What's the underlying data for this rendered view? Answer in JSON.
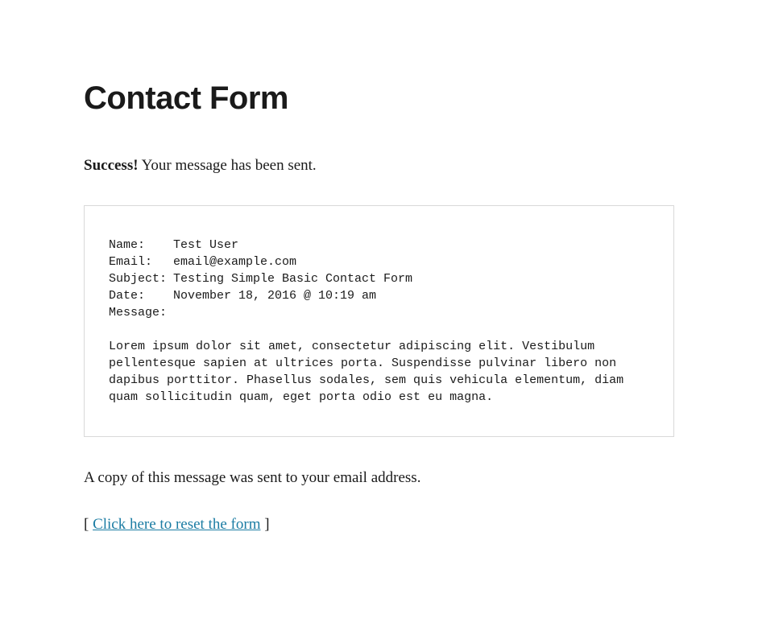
{
  "page": {
    "title": "Contact Form"
  },
  "success": {
    "bold": "Success!",
    "text": " Your message has been sent."
  },
  "fields": {
    "name_label": "Name:",
    "name_value": "Test User",
    "email_label": "Email:",
    "email_value": "email@example.com",
    "subject_label": "Subject:",
    "subject_value": "Testing Simple Basic Contact Form",
    "date_label": "Date:",
    "date_value": "November 18, 2016 @ 10:19 am",
    "message_label": "Message:",
    "message_body": "Lorem ipsum dolor sit amet, consectetur adipiscing elit. Vestibulum pellentesque sapien at ultrices porta. Suspendisse pulvinar libero non dapibus porttitor. Phasellus sodales, sem quis vehicula elementum, diam quam sollicitudin quam, eget porta odio est eu magna."
  },
  "copy_notice": "A copy of this message was sent to your email address.",
  "reset": {
    "left_bracket": "[ ",
    "link_text": "Click here to reset the form",
    "right_bracket": " ]"
  }
}
